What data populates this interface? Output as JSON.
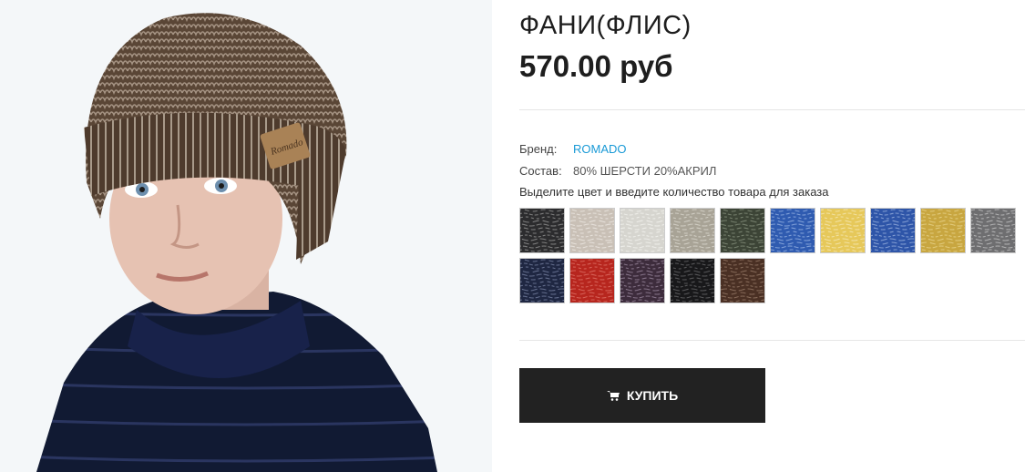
{
  "product": {
    "title": "ФАНИ(ФЛИС)",
    "price": "570.00 руб"
  },
  "attributes": {
    "brand_label": "Бренд:",
    "brand_value": "ROMADO",
    "composition_label": "Состав:",
    "composition_value": "80% ШЕРСТИ 20%АКРИЛ"
  },
  "color_hint": "Выделите цвет и введите количество товара для заказа",
  "swatches": [
    {
      "base": "#2c2c2e",
      "fleck": "#9a9a9a"
    },
    {
      "base": "#c9c0b6",
      "fleck": "#efebe6"
    },
    {
      "base": "#d6d5cf",
      "fleck": "#f4f4f0"
    },
    {
      "base": "#a8a396",
      "fleck": "#dedbd2"
    },
    {
      "base": "#3c4436",
      "fleck": "#8a9480"
    },
    {
      "base": "#2f5bb0",
      "fleck": "#9db8e6"
    },
    {
      "base": "#e6c85a",
      "fleck": "#f6eaba"
    },
    {
      "base": "#2e55a8",
      "fleck": "#9fb6e0"
    },
    {
      "base": "#c8a640",
      "fleck": "#e9d68f"
    },
    {
      "base": "#6e6e70",
      "fleck": "#c7c7c7"
    },
    {
      "base": "#1f2742",
      "fleck": "#7b86a6"
    },
    {
      "base": "#b7261e",
      "fleck": "#e0766b"
    },
    {
      "base": "#3d2c3c",
      "fleck": "#9c8aa0"
    },
    {
      "base": "#18181a",
      "fleck": "#6b6b6e"
    },
    {
      "base": "#4a3024",
      "fleck": "#9a7c69"
    }
  ],
  "buy_button": {
    "label": "КУПИТЬ",
    "icon": "cart-icon"
  }
}
